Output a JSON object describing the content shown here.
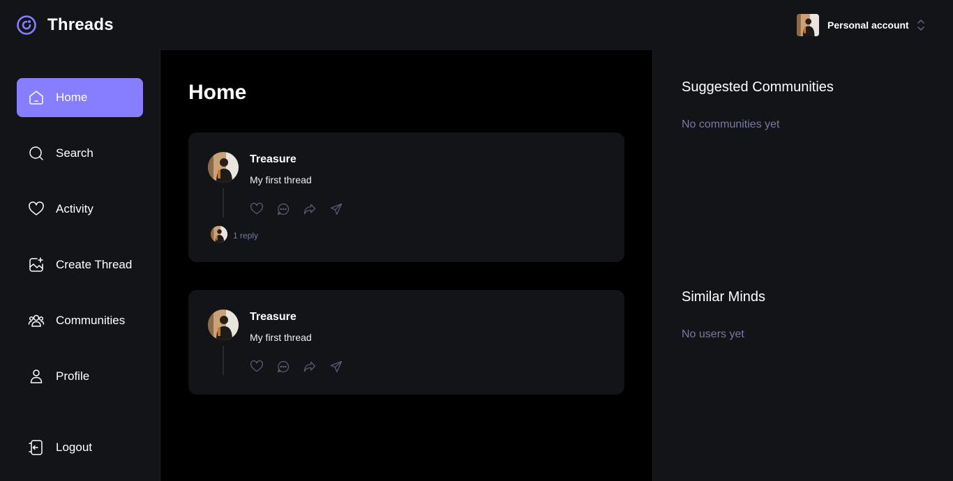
{
  "brand": {
    "name": "Threads",
    "logo_icon": "threads-logo-icon"
  },
  "account": {
    "label": "Personal account",
    "avatar": "user-avatar"
  },
  "sidebar": {
    "items": [
      {
        "label": "Home",
        "icon": "home-icon",
        "active": true
      },
      {
        "label": "Search",
        "icon": "search-icon",
        "active": false
      },
      {
        "label": "Activity",
        "icon": "heart-icon",
        "active": false
      },
      {
        "label": "Create Thread",
        "icon": "image-add-icon",
        "active": false
      },
      {
        "label": "Communities",
        "icon": "users-icon",
        "active": false
      },
      {
        "label": "Profile",
        "icon": "user-icon",
        "active": false
      }
    ],
    "logout_label": "Logout"
  },
  "main": {
    "title": "Home",
    "threads": [
      {
        "author": "Treasure",
        "text": "My first thread",
        "replies": "1 reply"
      },
      {
        "author": "Treasure",
        "text": "My first thread"
      }
    ]
  },
  "right": {
    "suggested_heading": "Suggested Communities",
    "suggested_empty": "No communities yet",
    "similar_heading": "Similar Minds",
    "similar_empty": "No users yet"
  },
  "colors": {
    "accent": "#877eff",
    "background": "#121417",
    "main_background": "#000000",
    "muted_text": "#7878a3"
  }
}
